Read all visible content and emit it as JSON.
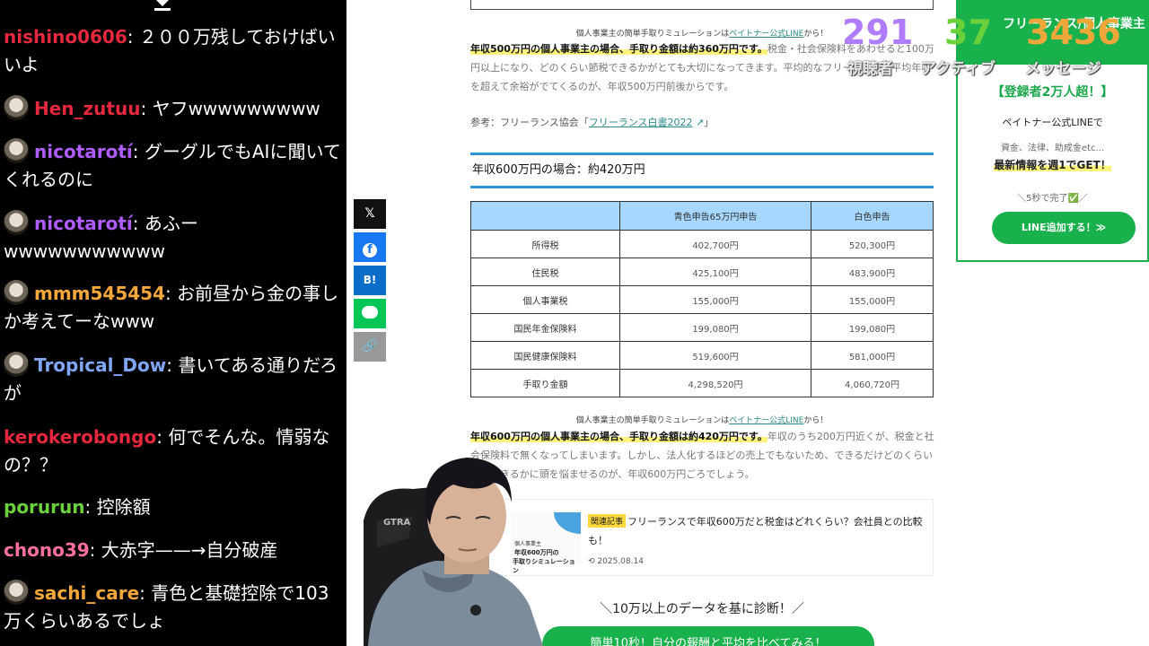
{
  "chat": {
    "messages": [
      {
        "user": "nishino0606",
        "color": "#e5283e",
        "text": "２００万残しておけばいいよ",
        "avatar": false
      },
      {
        "user": "Hen_zutuu",
        "color": "#e5283e",
        "text": "ヤフwwwwwwwww",
        "avatar": true
      },
      {
        "user": "nicotarotí",
        "color": "#b05cff",
        "text": "グーグルでもAIに聞いてくれるのに",
        "avatar": true
      },
      {
        "user": "nicotarotí",
        "color": "#b05cff",
        "text": "あふーwwwwwwwwwww",
        "avatar": true
      },
      {
        "user": "mmm545454",
        "color": "#f4a73b",
        "text": "お前昼から金の事しか考えてーなwww",
        "avatar": true
      },
      {
        "user": "Tropical_Dow",
        "color": "#7fa7f5",
        "text": "書いてある通りだろが",
        "avatar": true
      },
      {
        "user": "kerokerobongo",
        "color": "#e5283e",
        "text": "何でそんな。情弱なの？？",
        "avatar": false
      },
      {
        "user": "porurun",
        "color": "#6bd13b",
        "text": "控除額",
        "avatar": false
      },
      {
        "user": "chono39",
        "color": "#ff6fa0",
        "text": "大赤字——→自分破産",
        "avatar": false
      },
      {
        "user": "sachi_care",
        "color": "#f4a73b",
        "text": "青色と基礎控除で103万くらいあるでしょ",
        "avatar": true
      }
    ]
  },
  "overlay": {
    "viewers": {
      "value": "291",
      "label": "視聴者",
      "color": "#b07cff"
    },
    "active": {
      "value": "37",
      "label": "アクティブ",
      "color": "#6bd13b"
    },
    "messages": {
      "value": "3436",
      "label": "メッセージ",
      "color": "#f0a73a"
    }
  },
  "article": {
    "note1": {
      "prefix": "個人事業主の簡単手取りミュレーションは",
      "link": "ペイトナー公式LINE",
      "suffix": "から！"
    },
    "para1": {
      "highlight": "年収500万円の個人事業主の場合、手取り金額は約360万円です。",
      "rest": "税金・社会保険料をあわせると100万円以上になり、どのくらい節税できるかがとても大切になってきます。平均的なフリーランスの平均年収を超えて余裕がでてくるのが、年収500万円前後からです。"
    },
    "ref": {
      "prefix": "参考：フリーランス協会「",
      "link": "フリーランス白書2022",
      "suffix": "」"
    },
    "heading": "年収600万円の場合：約420万円",
    "table": {
      "headers": [
        "",
        "青色申告65万円申告",
        "白色申告"
      ],
      "rows": [
        [
          "所得税",
          "402,700円",
          "520,300円"
        ],
        [
          "住民税",
          "425,100円",
          "483,900円"
        ],
        [
          "個人事業税",
          "155,000円",
          "155,000円"
        ],
        [
          "国民年金保険料",
          "199,080円",
          "199,080円"
        ],
        [
          "国民健康保険料",
          "519,600円",
          "581,000円"
        ],
        [
          "手取り金額",
          "4,298,520円",
          "4,060,720円"
        ]
      ]
    },
    "note2": {
      "prefix": "個人事業主の簡単手取りミュレーションは",
      "link": "ペイトナー公式LINE",
      "suffix": "から！"
    },
    "para2": {
      "highlight": "年収600万円の個人事業主の場合、手取り金額は約420万円です。",
      "rest": "年収のうち200万円近くが、税金と社会保険料で無くなってしまいます。しかし、法人化するほどの売上でもないため、できるだけどのくらい節税できるかに頭を悩ませるのが、年収600万円ごろでしょう。"
    },
    "related": {
      "tag": "関連記事",
      "title": "フリーランスで年収600万だと税金はどれくらい？会社員との比較も！",
      "date": "2025.08.14",
      "thumb_small": "個人事業主",
      "thumb_line1": "年収600万円の",
      "thumb_line2": "手取りシミュレーション"
    },
    "diagnosis": "＼10万以上のデータを基に診断！／",
    "cta": "簡単10秒！自分の報酬と平均を比べてみる！"
  },
  "sidebar": {
    "top": "フリーランス/個人事業主",
    "registered": "【登録者2万人超！】",
    "line1": "ペイトナー公式LINEで",
    "line2": "資金、法律、助成金etc...",
    "line3": "最新情報を週1でGET！",
    "line4": "＼5秒で完了✅／",
    "button": "LINE追加する！≫"
  },
  "share": {
    "x": "𝕏",
    "facebook": "f",
    "hatena": "B!",
    "line": "",
    "copy": "🔗"
  }
}
